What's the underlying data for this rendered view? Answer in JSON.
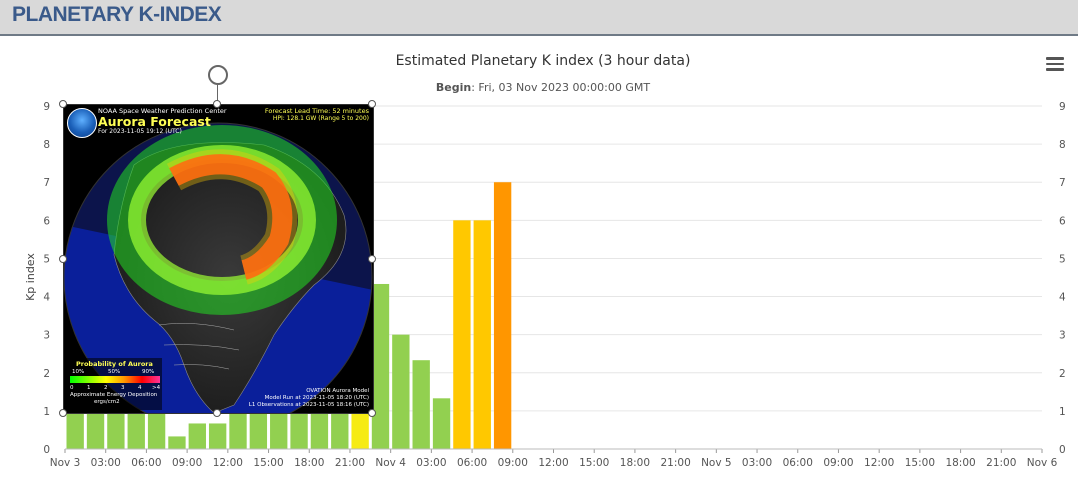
{
  "header": {
    "title": "PLANETARY K-INDEX"
  },
  "menu": {
    "icon": "hamburger-menu-icon"
  },
  "chart_data": {
    "type": "bar",
    "title": "Estimated Planetary K index (3 hour data)",
    "subtitle_label": "Begin",
    "subtitle_value": ": Fri, 03 Nov 2023 00:00:00 GMT",
    "ylabel": "Kp index",
    "xlabel": "",
    "ylim": [
      0,
      9
    ],
    "yticks": [
      0,
      1,
      2,
      3,
      4,
      5,
      6,
      7,
      8,
      9
    ],
    "grid": true,
    "xticks": [
      "Nov 3",
      "03:00",
      "06:00",
      "09:00",
      "12:00",
      "15:00",
      "18:00",
      "21:00",
      "Nov 4",
      "03:00",
      "06:00",
      "09:00",
      "12:00",
      "15:00",
      "18:00",
      "21:00",
      "Nov 5",
      "03:00",
      "06:00",
      "09:00",
      "12:00",
      "15:00",
      "18:00",
      "21:00",
      "Nov 6"
    ],
    "values": [
      1.0,
      1.0,
      1.0,
      1.0,
      1.0,
      0.33,
      0.67,
      0.67,
      1.0,
      1.0,
      2.0,
      1.0,
      1.67,
      3.0,
      4.67,
      4.33,
      3.0,
      2.33,
      1.33,
      6.0,
      6.0,
      7.0
    ],
    "colors": {
      "quiet": "#92d050",
      "kp5": "#f6eb14",
      "kp6": "#ffc800",
      "kp7": "#ff9600",
      "grid": "#e6e6e6"
    }
  },
  "overlay": {
    "org": "NOAA Space Weather Prediction Center",
    "name": "Aurora Forecast",
    "for_time": "For 2023-11-05 19:12 (UTC)",
    "lead_time": "Forecast Lead Time:  52 minutes",
    "hpi": "HPI: 128.1 GW (Range 5 to 200)",
    "legend_title": "Probability of Aurora",
    "legend_pct_10": "10%",
    "legend_pct_50": "50%",
    "legend_pct_90": "90%",
    "legend_nums": [
      "0",
      "1",
      "2",
      "3",
      "4",
      ">4"
    ],
    "legend_unit_1": "Approximate Energy Deposition",
    "legend_unit_2": "ergs/cm2",
    "model_1": "OVATION Aurora Model",
    "model_2": "Model Run at 2023-11-05 18:20 (UTC)",
    "model_3": "L1 Observations at 2023-11-05 18:16 (UTC)"
  }
}
